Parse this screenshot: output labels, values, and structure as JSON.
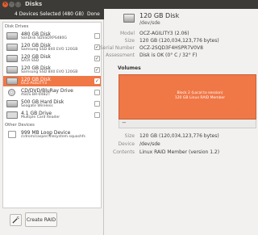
{
  "window": {
    "title": "Disks"
  },
  "selection_bar": {
    "text": "4 Devices Selected (480 GB)",
    "done_label": "Done"
  },
  "sections": {
    "disk_drives": "Disk Drives",
    "other_devices": "Other Devices"
  },
  "devices": [
    {
      "line1": "480 GB Disk",
      "line2": "SanDisk SDSSDXPS480G",
      "checked": false,
      "selected": false,
      "icon": "hard-disk-icon"
    },
    {
      "line1": "120 GB Disk",
      "line2": "Samsung SSD 840 EVO 120GB",
      "checked": true,
      "selected": false,
      "icon": "hard-disk-icon"
    },
    {
      "line1": "120 GB Disk",
      "line2": "SATA SSD",
      "checked": true,
      "selected": false,
      "icon": "hard-disk-icon"
    },
    {
      "line1": "120 GB Disk",
      "line2": "Samsung SSD 840 EVO 120GB",
      "checked": true,
      "selected": false,
      "icon": "hard-disk-icon"
    },
    {
      "line1": "120 GB Disk",
      "line2": "OCZ-AGILITY3",
      "checked": true,
      "selected": true,
      "icon": "hard-disk-icon"
    },
    {
      "line1": "CD/DVD/BluRay Drive",
      "line2": "ASUS    BR-04B2T",
      "checked": false,
      "selected": false,
      "icon": "optical-drive-icon"
    },
    {
      "line1": "500 GB Hard Disk",
      "line2": "Seagate Wireless",
      "checked": false,
      "selected": false,
      "icon": "hard-disk-icon"
    },
    {
      "line1": "4.1 GB Drive",
      "line2": "Multiple Card  Reader",
      "checked": false,
      "selected": false,
      "icon": "card-reader-icon"
    }
  ],
  "other_devices": [
    {
      "line1": "999 MB Loop Device",
      "line2": "/cdrom/casper/filesystem.squashfs",
      "checked": false,
      "selected": false,
      "icon": "file-icon"
    }
  ],
  "buttons": {
    "wand_icon": "wand-icon",
    "create_raid": "Create RAID"
  },
  "disk_header": {
    "title": "120 GB Disk",
    "path": "/dev/sde"
  },
  "properties": [
    {
      "key": "Model",
      "value": "OCZ-AGILITY3 (2.06)"
    },
    {
      "key": "Size",
      "value": "120 GB (120,034,123,776 bytes)"
    },
    {
      "key": "Serial Number",
      "value": "OCZ-2SQD3F4HSPR7V0V8"
    },
    {
      "key": "Assessment",
      "value": "Disk is OK (0° C / 32° F)"
    }
  ],
  "volumes": {
    "heading": "Volumes",
    "block_text": "Block 2 (Local to session)\n120 GB Linux RAID Member",
    "color": "#f07746"
  },
  "volume_properties": [
    {
      "key": "Size",
      "value": "120 GB (120,034,123,776 bytes)"
    },
    {
      "key": "Device",
      "value": "/dev/sde"
    },
    {
      "key": "Contents",
      "value": "Linux RAID Member (version 1.2)"
    }
  ],
  "colors": {
    "accent": "#f07746",
    "titlebar": "#3c3b37"
  }
}
